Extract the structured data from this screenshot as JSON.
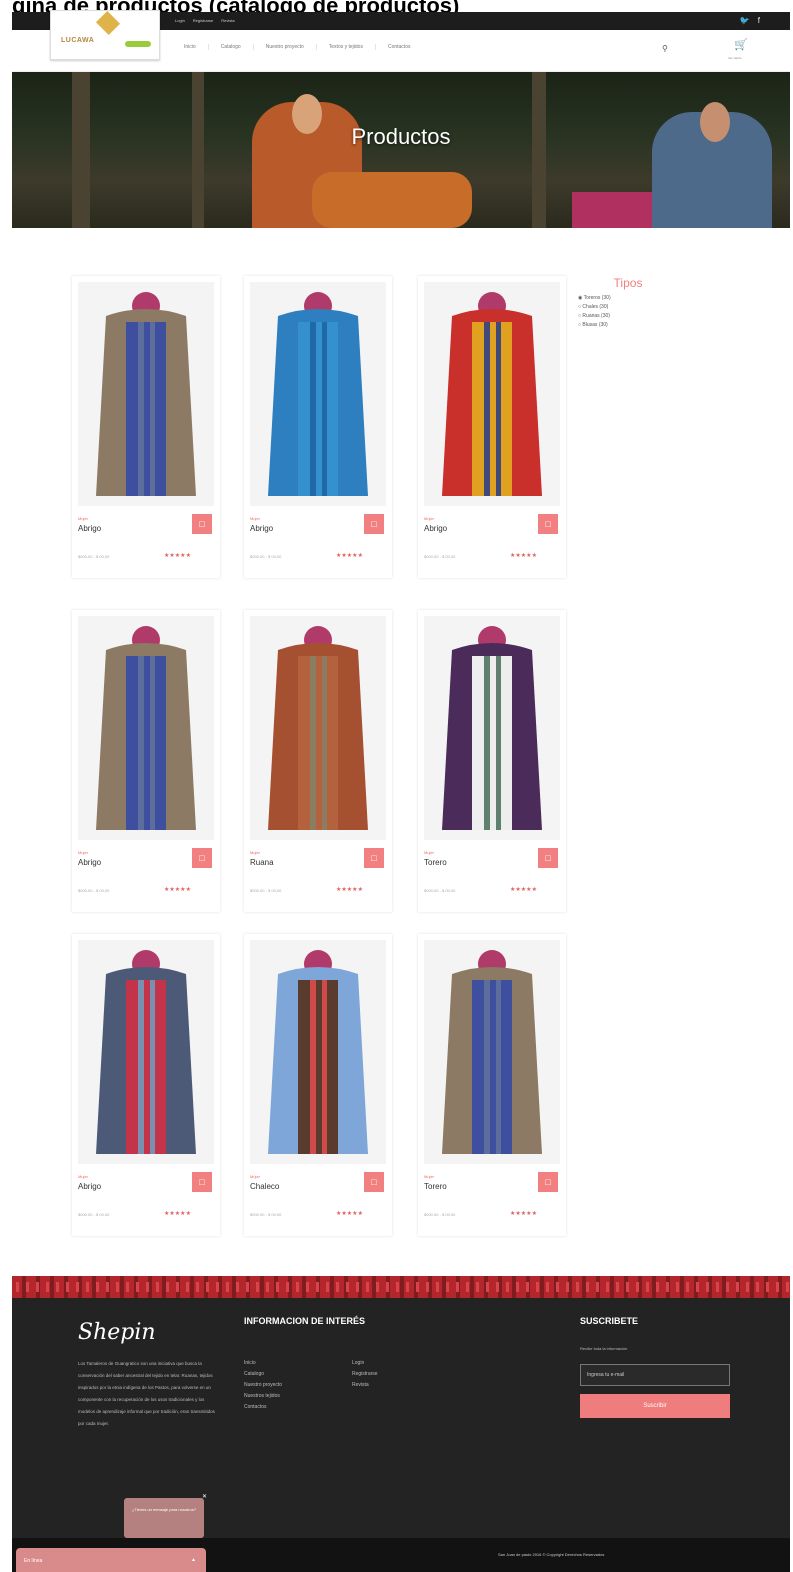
{
  "caption": "gina de productos (catalogo de productos)",
  "topbar": {
    "links": [
      "Login",
      "Registrarse",
      "Revista"
    ],
    "social": [
      "twitter-icon",
      "facebook-icon"
    ]
  },
  "logo": {
    "text": "LUCAWA"
  },
  "nav": {
    "items": [
      "Inicio",
      "Catalogo",
      "Nuestro proyecto",
      "Textos y tejidos",
      "Contactos"
    ],
    "cart_label": "Ver carrito"
  },
  "hero": {
    "title": "Productos"
  },
  "products": [
    {
      "category": "Mujer",
      "name": "Abrigo",
      "price": "$000,00 - $ 00,00",
      "rating": 5
    },
    {
      "category": "Mujer",
      "name": "Abrigo",
      "price": "$000,00 - $ 00,00",
      "rating": 5
    },
    {
      "category": "Mujer",
      "name": "Abrigo",
      "price": "$000,00 - $ 00,00",
      "rating": 5
    },
    {
      "category": "Mujer",
      "name": "Abrigo",
      "price": "$000,00 - $ 00,00",
      "rating": 5
    },
    {
      "category": "Mujer",
      "name": "Ruana",
      "price": "$000,00 - $ 00,00",
      "rating": 5
    },
    {
      "category": "Mujer",
      "name": "Torero",
      "price": "$000,00 - $ 00,00",
      "rating": 5
    },
    {
      "category": "Mujer",
      "name": "Abrigo",
      "price": "$000,00 - $ 00,00",
      "rating": 5
    },
    {
      "category": "Mujer",
      "name": "Chaleco",
      "price": "$000,00 - $ 00,00",
      "rating": 5
    },
    {
      "category": "Mujer",
      "name": "Torero",
      "price": "$000,00 - $ 00,00",
      "rating": 5
    }
  ],
  "sidebar": {
    "title": "Tipos",
    "options": [
      "Toreros (30)",
      "Chales (30)",
      "Ruanas (30)",
      "Blusas (30)"
    ]
  },
  "footer": {
    "brand": "Shepin",
    "description": "Los Tamaleros de Guangratico son una iniciativa que busca la conservación del saber ancestral del tejido en telar. Ruanas, tejidos inspirados por la etnia indígena de los Pastos, para volverse en un componente con la recuperación de los usos tradicionales y los modelos de aprendizaje informal que por tradición, eran transmitidos por cada mujer.",
    "info_heading": "INFORMACION DE INTERÉS",
    "links_col1": [
      "Inicio",
      "Catalogo",
      "Nuestro proyecto",
      "Nuestros tejidos",
      "Contactos"
    ],
    "links_col2": [
      "Login",
      "Registrarse",
      "Revista"
    ],
    "subscribe_heading": "SUSCRIBETE",
    "subscribe_text": "Recibe toda la información",
    "email_placeholder": "Ingresa tu e-mail",
    "subscribe_button": "Suscribir",
    "copyright": "San Juan de pasto 2016 © Copyright Derechos Reservados"
  },
  "chat": {
    "popup_text": "¿Tienes un mensaje para nosotros?",
    "bar_label": "En línea"
  },
  "colors": {
    "accent": "#f07d7d",
    "footer_bg": "#232323"
  }
}
